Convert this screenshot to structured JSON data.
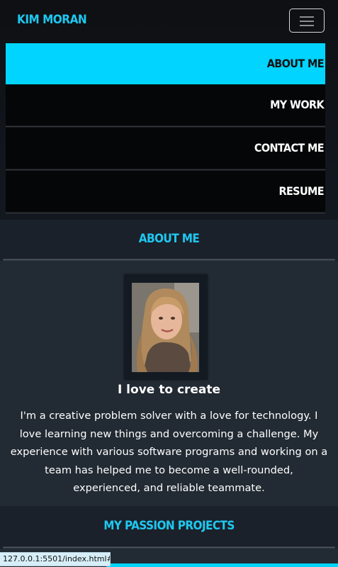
{
  "navbar": {
    "brand": "Kim Moran",
    "toggler_icon": "hamburger-icon",
    "items": [
      {
        "label": "About Me",
        "active": true
      },
      {
        "label": "My Work",
        "active": false
      },
      {
        "label": "Contact Me",
        "active": false
      },
      {
        "label": "Resume",
        "active": false
      }
    ]
  },
  "about": {
    "heading": "About Me",
    "tagline": "I love to create",
    "body": "I'm a creative problem solver with a love for technology. I love learning new things and overcoming a challenge. My experience with various software programs and working on a team has helped me to become a well-rounded, experienced, and reliable teammate."
  },
  "projects": {
    "heading": "My Passion Projects"
  },
  "status_bar": {
    "url": "127.0.0.1:5501/index.html#..."
  },
  "colors": {
    "accent": "#00d4ff",
    "heading_text": "#1ec8f0",
    "page_bg": "#222a33"
  }
}
